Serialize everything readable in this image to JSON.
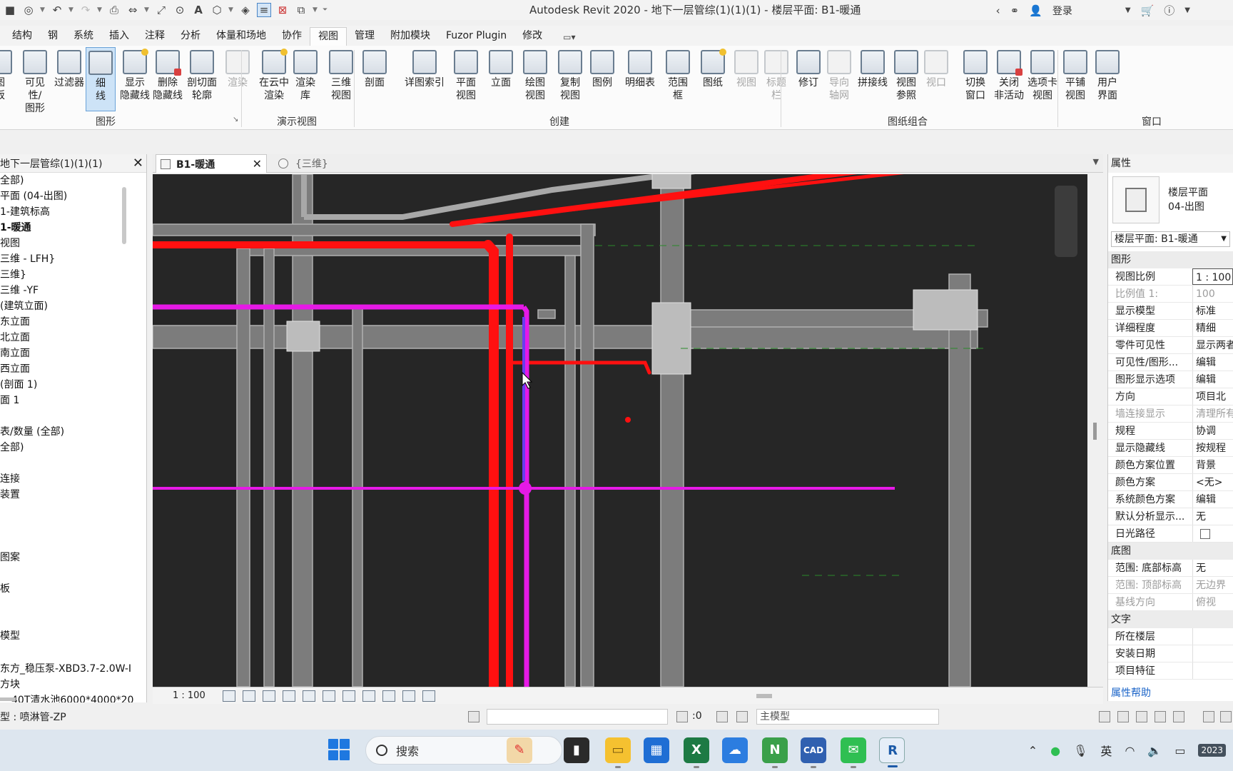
{
  "titlebar": {
    "title": "Autodesk Revit 2020 - 地下一层管综(1)(1)(1) - 楼层平面: B1-暖通",
    "login": "登录"
  },
  "ribbon_tabs": [
    "结构",
    "钢",
    "系统",
    "插入",
    "注释",
    "分析",
    "体量和场地",
    "协作",
    "视图",
    "管理",
    "附加模块",
    "Fuzor Plugin",
    "修改"
  ],
  "active_tab": "视图",
  "ribbon": {
    "buttons": [
      {
        "label": "图\n板",
        "state": "normal"
      },
      {
        "label": "可见性/\n图形",
        "state": "normal"
      },
      {
        "label": "过滤器",
        "state": "normal"
      },
      {
        "label": "细\n线",
        "state": "selected"
      },
      {
        "label": "显示\n隐藏线",
        "state": "normal"
      },
      {
        "label": "删除\n隐藏线",
        "state": "normal"
      },
      {
        "label": "剖切面\n轮廓",
        "state": "normal"
      },
      {
        "label": "渲染",
        "state": "disabled"
      },
      {
        "label": "在云中\n渲染",
        "state": "normal"
      },
      {
        "label": "渲染\n库",
        "state": "normal"
      },
      {
        "label": "三维\n视图",
        "state": "normal"
      },
      {
        "label": "剖面",
        "state": "normal"
      },
      {
        "label": "详图索引",
        "state": "normal"
      },
      {
        "label": "平面\n视图",
        "state": "normal"
      },
      {
        "label": "立面",
        "state": "normal"
      },
      {
        "label": "绘图\n视图",
        "state": "normal"
      },
      {
        "label": "复制\n视图",
        "state": "normal"
      },
      {
        "label": "图例",
        "state": "normal"
      },
      {
        "label": "明细表",
        "state": "normal"
      },
      {
        "label": "范围\n框",
        "state": "normal"
      },
      {
        "label": "图纸",
        "state": "normal"
      },
      {
        "label": "视图",
        "state": "disabled"
      },
      {
        "label": "标题\n栏",
        "state": "disabled"
      },
      {
        "label": "修订",
        "state": "normal"
      },
      {
        "label": "导向\n轴网",
        "state": "disabled"
      },
      {
        "label": "拼接线",
        "state": "normal"
      },
      {
        "label": "视图\n参照",
        "state": "normal"
      },
      {
        "label": "视口",
        "state": "disabled"
      },
      {
        "label": "切换\n窗口",
        "state": "normal"
      },
      {
        "label": "关闭\n非活动",
        "state": "normal"
      },
      {
        "label": "选项卡\n视图",
        "state": "normal"
      },
      {
        "label": "平铺\n视图",
        "state": "normal"
      },
      {
        "label": "用户\n界面",
        "state": "normal"
      }
    ],
    "panels": [
      "图形",
      "演示视图",
      "创建",
      "图纸组合",
      "窗口"
    ]
  },
  "project_browser": {
    "title": "地下一层管综(1)(1)(1)",
    "items": [
      {
        "text": "全部)",
        "bold": false
      },
      {
        "text": "平面 (04-出图)",
        "bold": false
      },
      {
        "text": "1-建筑标高",
        "bold": false
      },
      {
        "text": "1-暖通",
        "bold": true
      },
      {
        "text": "视图",
        "bold": false
      },
      {
        "text": "三维 - LFH}",
        "bold": false
      },
      {
        "text": "三维}",
        "bold": false
      },
      {
        "text": "三维 -YF",
        "bold": false
      },
      {
        "text": "(建筑立面)",
        "bold": false
      },
      {
        "text": "东立面",
        "bold": false
      },
      {
        "text": "北立面",
        "bold": false
      },
      {
        "text": "南立面",
        "bold": false
      },
      {
        "text": "西立面",
        "bold": false
      },
      {
        "text": "(剖面 1)",
        "bold": false
      },
      {
        "text": "面 1",
        "bold": false
      },
      {
        "text": "",
        "bold": false
      },
      {
        "text": "表/数量 (全部)",
        "bold": false
      },
      {
        "text": "全部)",
        "bold": false
      },
      {
        "text": "",
        "bold": false
      },
      {
        "text": "连接",
        "bold": false
      },
      {
        "text": "装置",
        "bold": false
      },
      {
        "text": "",
        "bold": false
      },
      {
        "text": "",
        "bold": false
      },
      {
        "text": "",
        "bold": false
      },
      {
        "text": "图案",
        "bold": false
      },
      {
        "text": "",
        "bold": false
      },
      {
        "text": "板",
        "bold": false
      },
      {
        "text": "",
        "bold": false
      },
      {
        "text": "",
        "bold": false
      },
      {
        "text": "模型",
        "bold": false
      },
      {
        "text": "",
        "bold": false
      },
      {
        "text": "东方_稳压泵-XBD3.7-2.0W-I",
        "bold": false
      },
      {
        "text": "方块",
        "bold": false
      },
      {
        "text": "40T清水池6000*4000*20",
        "bold": false
      }
    ]
  },
  "view_tabs": [
    {
      "label": "B1-暖通",
      "active": true
    },
    {
      "label": "{三维}",
      "active": false
    }
  ],
  "view_control": {
    "scale": "1 : 100"
  },
  "properties": {
    "title": "属性",
    "type_name": "楼层平面\n04-出图",
    "type_select": "楼层平面: B1-暖通",
    "groups": [
      {
        "name": "图形",
        "rows": [
          {
            "name": "视图比例",
            "value": "1 : 100",
            "dim": false,
            "boxed": true
          },
          {
            "name": "比例值 1:",
            "value": "100",
            "dim": true
          },
          {
            "name": "显示模型",
            "value": "标准",
            "dim": false
          },
          {
            "name": "详细程度",
            "value": "精细",
            "dim": false
          },
          {
            "name": "零件可见性",
            "value": "显示两者",
            "dim": false
          },
          {
            "name": "可见性/图形...",
            "value": "编辑",
            "dim": false
          },
          {
            "name": "图形显示选项",
            "value": "编辑",
            "dim": false
          },
          {
            "name": "方向",
            "value": "项目北",
            "dim": false
          },
          {
            "name": "墙连接显示",
            "value": "清理所有",
            "dim": true
          },
          {
            "name": "规程",
            "value": "协调",
            "dim": false
          },
          {
            "name": "显示隐藏线",
            "value": "按规程",
            "dim": false
          },
          {
            "name": "颜色方案位置",
            "value": "背景",
            "dim": false
          },
          {
            "name": "颜色方案",
            "value": "<无>",
            "dim": false
          },
          {
            "name": "系统颜色方案",
            "value": "编辑",
            "dim": false
          },
          {
            "name": "默认分析显示...",
            "value": "无",
            "dim": false
          },
          {
            "name": "日光路径",
            "value": "",
            "dim": false,
            "checkbox": true
          }
        ]
      },
      {
        "name": "底图",
        "rows": [
          {
            "name": "范围: 底部标高",
            "value": "无",
            "dim": false
          },
          {
            "name": "范围: 顶部标高",
            "value": "无边界",
            "dim": true
          },
          {
            "name": "基线方向",
            "value": "俯视",
            "dim": true
          }
        ]
      },
      {
        "name": "文字",
        "rows": [
          {
            "name": "所在楼层",
            "value": "",
            "dim": false
          },
          {
            "name": "安装日期",
            "value": "",
            "dim": false
          },
          {
            "name": "项目特征",
            "value": "",
            "dim": false
          }
        ]
      }
    ],
    "help_link": "属性帮助"
  },
  "statusbar": {
    "text": "型 : 喷淋管-ZP",
    "zero": ":0",
    "model": "主模型"
  },
  "taskbar": {
    "search_label": "搜索",
    "ime": "英",
    "clock": "2023"
  },
  "colors": {
    "canvas_bg": "#262626",
    "pipe_red": "#ff1010",
    "pipe_magenta": "#e619e6",
    "pipe_blue": "#6a3cf0",
    "duct_gray": "#8a8a8a",
    "selection_blue": "#cde3f7"
  }
}
